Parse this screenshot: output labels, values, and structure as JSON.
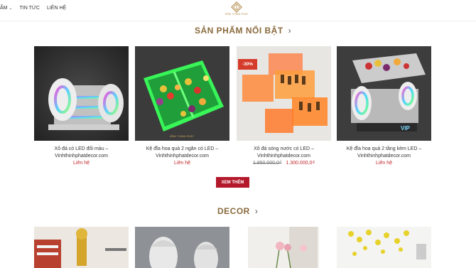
{
  "nav": {
    "items": [
      {
        "label": "ẨM",
        "has_dropdown": true
      },
      {
        "label": "TIN TỨC",
        "has_dropdown": false
      },
      {
        "label": "LIÊN HỆ",
        "has_dropdown": false
      }
    ]
  },
  "logo": {
    "text": "VĨNH THỊNH PHÁT"
  },
  "featured": {
    "title": "SẢN PHẨM NỔI BẬT",
    "products": [
      {
        "name_line1": "Xô đá có LED đổi màu –",
        "name_line2": "Vinhthinhphatdecor.com",
        "price": "Liên hệ"
      },
      {
        "name_line1": "Kệ đĩa hoa quả 2 ngăn có LED –",
        "name_line2": "Vinhthinhphatdecor.com",
        "price": "Liên hệ"
      },
      {
        "name_line1": "Xô đá sóng nước có LED –",
        "name_line2": "Vinhthinhphatdecor.com",
        "old_price": "1.850.000,0₫",
        "new_price": "1.300.000,0₫",
        "badge": "-30%"
      },
      {
        "name_line1": "Kệ đĩa hoa quả 2 tầng kèm LED –",
        "name_line2": "Vinhthinhphatdecor.com",
        "price": "Liên hệ"
      }
    ],
    "more_label": "XEM THÊM"
  },
  "decor": {
    "title": "DECOR"
  },
  "colors": {
    "accent": "#b3192b",
    "title_gold": "#8a6a3d",
    "price_red": "#c0282d"
  }
}
